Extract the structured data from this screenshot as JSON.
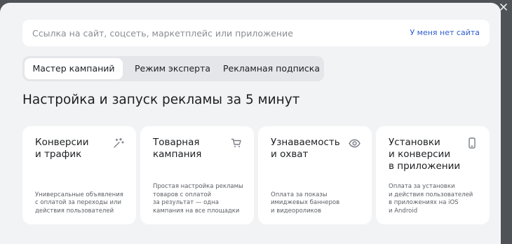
{
  "search": {
    "placeholder": "Ссылка на сайт, соцсеть, маркетплейс или приложение",
    "value": "",
    "no_site_label": "У меня нет сайта"
  },
  "tabs": [
    {
      "label": "Мастер кампаний",
      "active": true
    },
    {
      "label": "Режим эксперта",
      "active": false
    },
    {
      "label": "Рекламная подписка",
      "active": false
    }
  ],
  "title": "Настройка и запуск рекламы за 5 минут",
  "cards": [
    {
      "title": "Конверсии\nи трафик",
      "icon": "magic-wand-icon",
      "description": "Универсальные объявления\nс оплатой за переходы или\nдействия пользователей"
    },
    {
      "title": "Товарная\nкампания",
      "icon": "cart-icon",
      "description": "Простая настройка рекламы\nтоваров с оплатой\nза результат — одна\nкампания на все площадки"
    },
    {
      "title": "Узнаваемость\nи охват",
      "icon": "eye-icon",
      "description": "Оплата за показы\nимиджевых баннеров\nи видеороликов"
    },
    {
      "title": "Установки\nи конверсии\nв приложении",
      "icon": "smartphone-icon",
      "description": "Оплата за установки\nи действия пользователей\nв приложениях на iOS\nи Android"
    }
  ],
  "colors": {
    "background": "#f2f3f5",
    "card": "#ffffff",
    "link": "#2f5dcd",
    "tabs_bg": "#e4e6e9"
  }
}
